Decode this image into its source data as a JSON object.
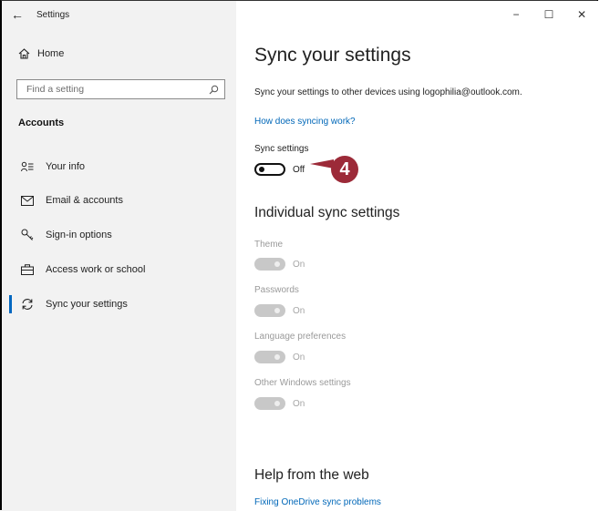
{
  "window": {
    "title": "Settings",
    "controls": [
      "−",
      "☐",
      "✕"
    ]
  },
  "sidebar": {
    "home_label": "Home",
    "search_placeholder": "Find a setting",
    "section_title": "Accounts",
    "items": [
      {
        "label": "Your info",
        "icon": "person-list-icon"
      },
      {
        "label": "Email & accounts",
        "icon": "mail-icon"
      },
      {
        "label": "Sign-in options",
        "icon": "key-icon"
      },
      {
        "label": "Access work or school",
        "icon": "briefcase-icon"
      },
      {
        "label": "Sync your settings",
        "icon": "sync-icon",
        "active": true
      }
    ]
  },
  "main": {
    "title": "Sync your settings",
    "description": "Sync your settings to other devices using logophilia@outlook.com.",
    "how_link": "How does syncing work?",
    "sync_settings_label": "Sync settings",
    "sync_state": "Off",
    "individual_heading": "Individual sync settings",
    "individual": [
      {
        "label": "Theme",
        "state": "On"
      },
      {
        "label": "Passwords",
        "state": "On"
      },
      {
        "label": "Language preferences",
        "state": "On"
      },
      {
        "label": "Other Windows settings",
        "state": "On"
      }
    ],
    "help_heading": "Help from the web",
    "help_link": "Fixing OneDrive sync problems"
  },
  "callout": {
    "number": "4",
    "color": "#9c2a38"
  }
}
